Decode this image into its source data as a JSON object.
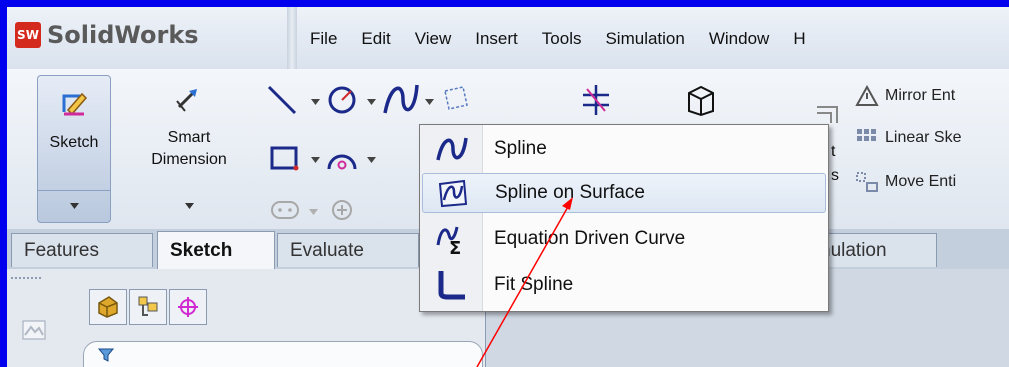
{
  "app": {
    "name": "SolidWorks",
    "badge": "SW"
  },
  "menu": [
    "File",
    "Edit",
    "View",
    "Insert",
    "Tools",
    "Simulation",
    "Window",
    "H"
  ],
  "ribbon": {
    "sketch_label": "Sketch",
    "smart_dimension_line1": "Smart",
    "smart_dimension_line2": "Dimension",
    "partial_t": "t",
    "partial_s": "s",
    "right_items": [
      "Mirror Ent",
      "Linear Ske",
      "Move Enti"
    ]
  },
  "tabs": [
    "Features",
    "Sketch",
    "Evaluate",
    "nulation"
  ],
  "popup": {
    "items": [
      "Spline",
      "Spline on Surface",
      "Equation Driven Curve",
      "Fit Spline"
    ],
    "highlighted": 1
  },
  "chevron": "»",
  "colors": {
    "background": "#0000ee",
    "annotation_arrow": "#ff0000",
    "highlight": "#dde7f3"
  }
}
